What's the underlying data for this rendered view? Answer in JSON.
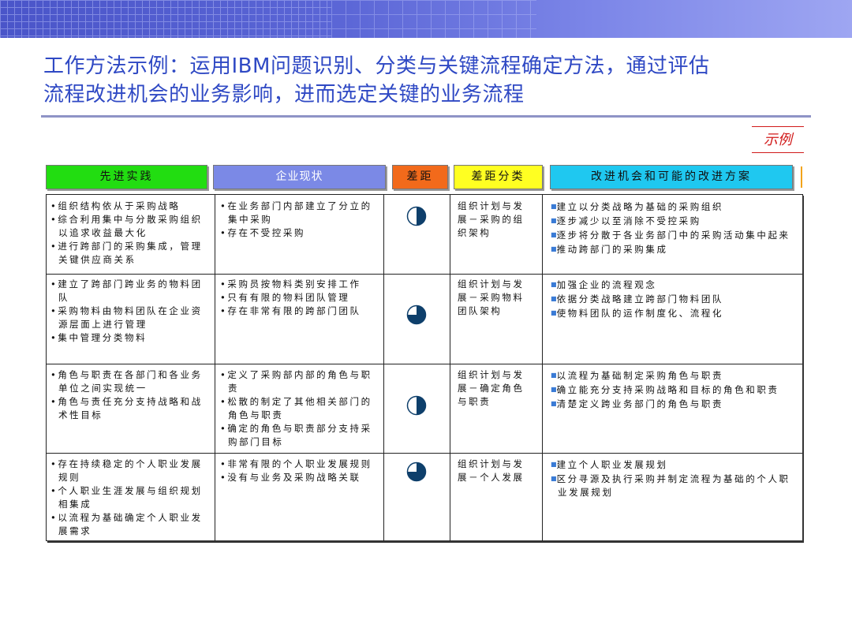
{
  "title": {
    "line1": "工作方法示例：运用IBM问题识别、分类与关键流程确定方法，通过评估",
    "line2": "流程改进机会的业务影响，进而选定关键的业务流程"
  },
  "example_label": "示例",
  "headers": {
    "best_practice": "先进实践",
    "current_state": "企业现状",
    "gap": "差距",
    "gap_category": "差距分类",
    "improvement": "改进机会和可能的改进方案"
  },
  "rows": [
    {
      "best_practice": [
        "•组织结构依从于采购战略",
        "•综合利用集中与分散采购组织以追求收益最大化",
        "•进行跨部门的采购集成，管理关键供应商关系"
      ],
      "current_state": [
        "•在业务部门内部建立了分立的集中采购",
        "•存在不受控采购"
      ],
      "gap_level": 0.5,
      "gap_category": "组织计划与发展－采购的组织架构",
      "improvement": [
        "建立以分类战略为基础的采购组织",
        "逐步减少以至消除不受控采购",
        "逐步将分散于各业务部门中的采购活动集中起来",
        "推动跨部门的采购集成"
      ]
    },
    {
      "best_practice": [
        "•建立了跨部门跨业务的物料团队",
        "•采购物料由物料团队在企业资源层面上进行管理",
        "•集中管理分类物料"
      ],
      "current_state": [
        "•采购员按物料类别安排工作",
        "•只有有限的物料团队管理",
        "•存在非常有限的跨部门团队"
      ],
      "gap_level": 0.75,
      "gap_category": "组织计划与发展－采购物料团队架构",
      "improvement": [
        "加强企业的流程观念",
        "依据分类战略建立跨部门物料团队",
        "使物料团队的运作制度化、流程化"
      ]
    },
    {
      "best_practice": [
        "•角色与职责在各部门和各业务单位之间实现统一",
        "•角色与责任充分支持战略和战术性目标"
      ],
      "current_state": [
        "•定义了采购部内部的角色与职责",
        "•松散的制定了其他相关部门的角色与职责",
        "•确定的角色与职责部分支持采购部门目标"
      ],
      "gap_level": 0.5,
      "gap_category": "组织计划与发展－确定角色与职责",
      "improvement": [
        "以流程为基础制定采购角色与职责",
        "确立能充分支持采购战略和目标的角色和职责",
        "清楚定义跨业务部门的角色与职责"
      ]
    },
    {
      "best_practice": [
        "•存在持续稳定的个人职业发展规则",
        "•个人职业生涯发展与组织规划相集成",
        "•以流程为基础确定个人职业发展需求"
      ],
      "current_state": [
        "•非常有限的个人职业发展规则",
        "•没有与业务及采购战略关联"
      ],
      "gap_level": 0.75,
      "gap_category": "组织计划与发展－个人发展",
      "improvement": [
        "建立个人职业发展规划",
        "区分寻源及执行采购并制定流程为基础的个人职业发展规划"
      ]
    }
  ],
  "colors": {
    "title": "#2f49c4",
    "best_practice_header": "#22dd11",
    "current_state_header": "#7b89e6",
    "gap_header": "#f26a1b",
    "gap_category_header": "#ffff22",
    "improvement_header": "#1fc8f0",
    "pie_fill": "#0e3f6b",
    "example_label": "#d11a1a"
  }
}
